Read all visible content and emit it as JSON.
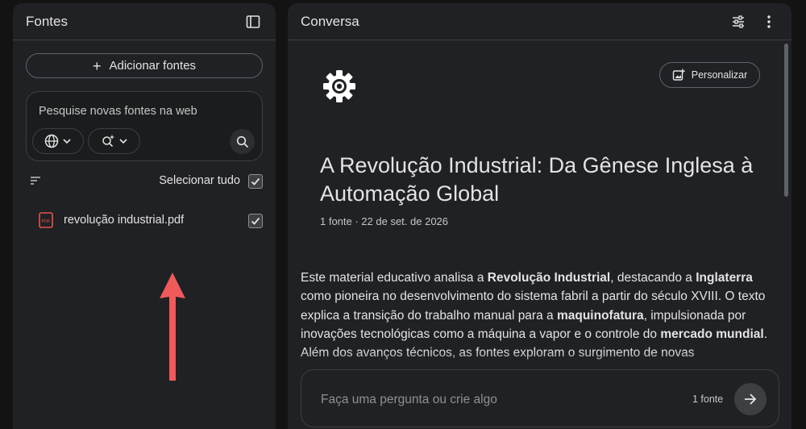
{
  "sources_panel": {
    "title": "Fontes",
    "add_sources_label": "Adicionar fontes",
    "web_search": {
      "placeholder": "Pesquise novas fontes na web"
    },
    "select_all_label": "Selecionar tudo",
    "files": [
      {
        "name": "revolução industrial.pdf",
        "type_badge": "PDF",
        "checked": true
      }
    ]
  },
  "chat_panel": {
    "title": "Conversa",
    "personalize_label": "Personalizar",
    "notebook_title": "A Revolução Industrial: Da Gênese Inglesa à Automação Global",
    "meta": "1 fonte · 22 de set. de 2026",
    "summary_parts": [
      "Este material educativo analisa a ",
      "Revolução Industrial",
      ", destacando a ",
      "Inglaterra",
      " como pioneira no desenvolvimento do sistema fabril a partir do século XVIII. O texto explica a transição do trabalho manual para a ",
      "maquinofatura",
      ", impulsionada por inovações tecnológicas como a máquina a vapor e o controle do ",
      "mercado mundial",
      ". Além dos avanços técnicos, as fontes exploram o surgimento de novas"
    ],
    "input": {
      "placeholder": "Faça uma pergunta ou crie algo",
      "source_count": "1 fonte"
    }
  },
  "icons": {
    "panel_toggle": "dock-left-icon",
    "tune": "tune-icon",
    "more": "more-vert-icon",
    "globe": "globe-icon",
    "research": "sparkle-search-icon",
    "search": "search-icon",
    "sort": "sort-icon",
    "pdf": "pdf-file-icon",
    "gear": "gear-icon",
    "send": "arrow-forward-icon",
    "arrow_annotation": "red-up-arrow-icon"
  },
  "colors": {
    "background": "#131314",
    "panel": "#202124",
    "pdf_red": "#e5534b",
    "annotation_arrow": "#f05a5a"
  }
}
